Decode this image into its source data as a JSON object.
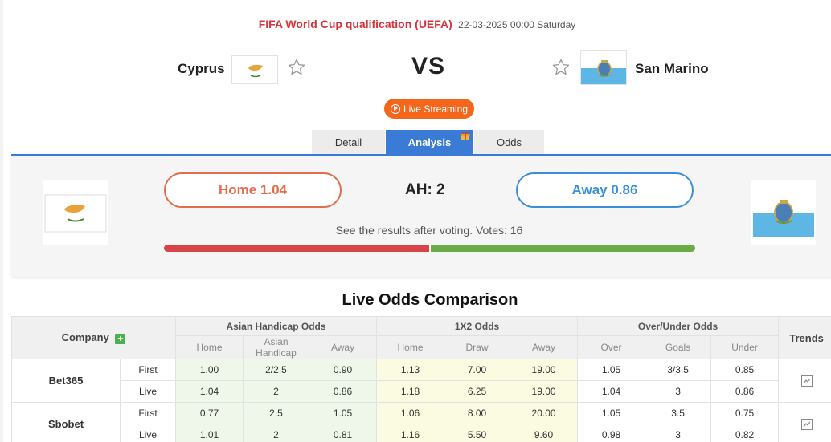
{
  "match": {
    "league": "FIFA World Cup qualification (UEFA)",
    "datetime": "22-03-2025 00:00 Saturday",
    "home_team": "Cyprus",
    "away_team": "San Marino",
    "vs": "VS",
    "live_label": "Live Streaming"
  },
  "tabs": [
    "Detail",
    "Analysis",
    "Odds"
  ],
  "vote": {
    "home_label": "Home 1.04",
    "away_label": "Away 0.86",
    "handicap": "AH: 2",
    "note": "See the results after voting. Votes: 16",
    "home_share": 0.5,
    "colors": {
      "home": "#e06d4b",
      "away": "#3a8fd8",
      "bar_home": "#d9444a",
      "bar_away": "#6bab4a"
    }
  },
  "odds": {
    "title": "Live Odds Comparison",
    "company_header": "Company",
    "trends_header": "Trends",
    "groups": [
      "Asian Handicap Odds",
      "1X2 Odds",
      "Over/Under Odds"
    ],
    "subheaders": [
      "Home",
      "Asian Handicap",
      "Away",
      "Home",
      "Draw",
      "Away",
      "Over",
      "Goals",
      "Under"
    ],
    "bookmakers": [
      {
        "name": "Bet365",
        "rows": [
          {
            "type": "First",
            "values": [
              "1.00",
              "2/2.5",
              "0.90",
              "1.13",
              "7.00",
              "19.00",
              "1.05",
              "3/3.5",
              "0.85"
            ]
          },
          {
            "type": "Live",
            "values": [
              "1.04",
              "2",
              "0.86",
              "1.18",
              "6.25",
              "19.00",
              "1.04",
              "3",
              "0.86"
            ]
          }
        ]
      },
      {
        "name": "Sbobet",
        "rows": [
          {
            "type": "First",
            "values": [
              "0.77",
              "2.5",
              "1.05",
              "1.06",
              "8.00",
              "20.00",
              "1.05",
              "3.5",
              "0.75"
            ]
          },
          {
            "type": "Live",
            "values": [
              "1.01",
              "2",
              "0.81",
              "1.16",
              "5.50",
              "9.60",
              "0.98",
              "3",
              "0.82"
            ]
          }
        ]
      }
    ]
  }
}
